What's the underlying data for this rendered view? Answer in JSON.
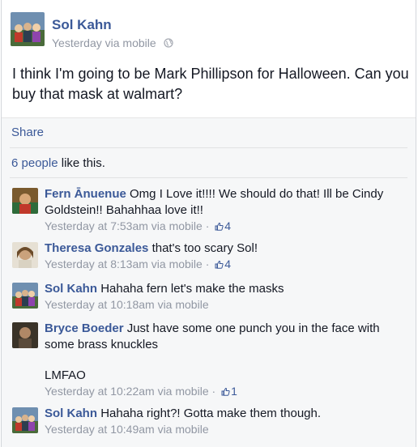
{
  "post": {
    "author": "Sol Kahn",
    "meta": "Yesterday via mobile",
    "privacy_icon": "globe-icon",
    "text": "I think I'm going to be Mark Phillipson for Halloween. Can you buy that mask at walmart?"
  },
  "actions": {
    "share": "Share"
  },
  "likes": {
    "count": "6 people",
    "suffix": " like this."
  },
  "comments": [
    {
      "name": "Fern Ānuenue",
      "text": "Omg I Love it!!!! We should do that! Ill be Cindy Goldstein!! Bahahhaa love it!!",
      "time": "Yesterday at 7:53am via mobile",
      "sep": " · ",
      "likes": "4"
    },
    {
      "name": "Theresa Gonzales",
      "text": "that's too scary Sol!",
      "time": "Yesterday at 8:13am via mobile",
      "sep": " · ",
      "likes": "4"
    },
    {
      "name": "Sol Kahn",
      "text": "Hahaha fern let's make the masks",
      "time": "Yesterday at 10:18am via mobile"
    },
    {
      "name": "Bryce Boeder",
      "text": "Just have some one punch you in the face with some brass knuckles",
      "text2": "LMFAO",
      "time": "Yesterday at 10:22am via mobile",
      "sep": " · ",
      "likes": "1"
    },
    {
      "name": "Sol Kahn",
      "text": "Hahaha right?! Gotta make them though.",
      "time": "Yesterday at 10:49am via mobile"
    }
  ],
  "colors": {
    "link": "#3b5998",
    "meta": "#9197a3",
    "panel": "#f6f7f8"
  }
}
